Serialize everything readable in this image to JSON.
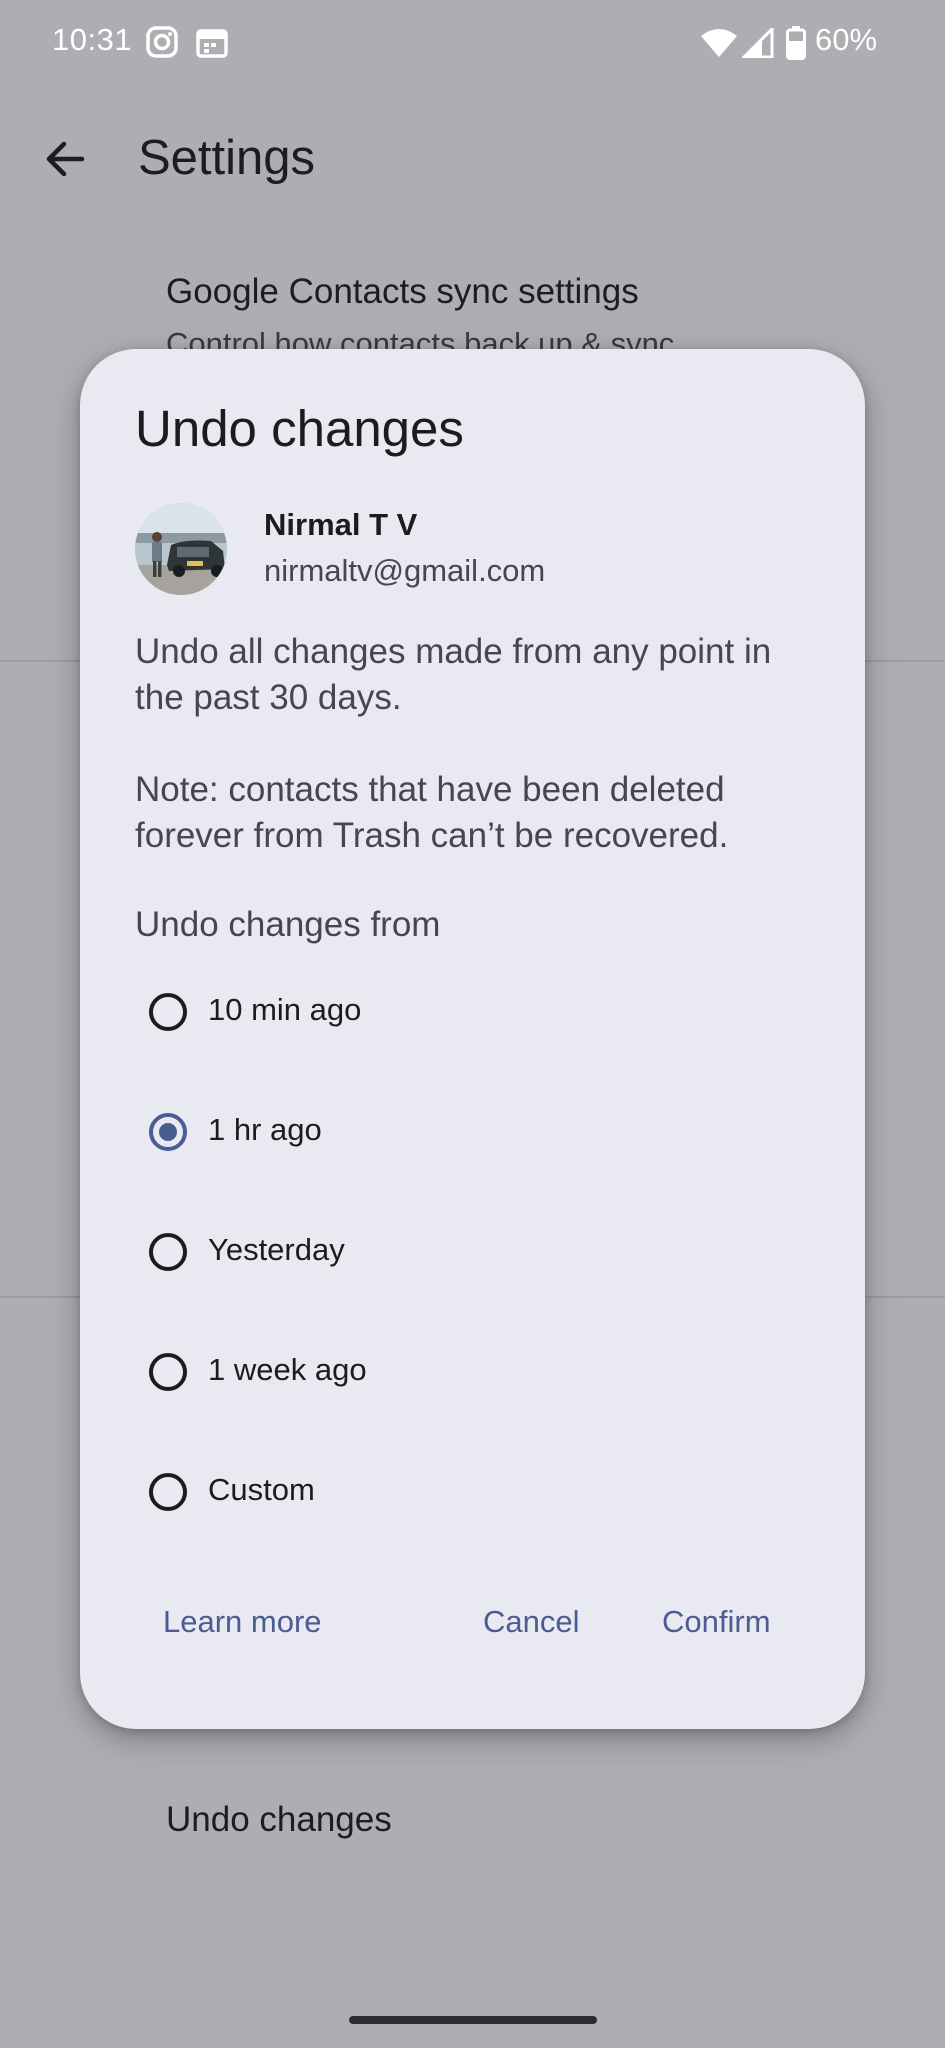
{
  "status_bar": {
    "time": "10:31",
    "battery": "60%"
  },
  "background": {
    "title": "Settings",
    "sync_item_title": "Google Contacts sync settings",
    "sync_item_subtitle": "Control how contacts back up & sync",
    "undo_item_title": "Undo changes"
  },
  "dialog": {
    "title": "Undo changes",
    "account": {
      "name": "Nirmal T V",
      "email": "nirmaltv@gmail.com"
    },
    "description": "Undo all changes made from any point in the past 30 days.",
    "note": "Note: contacts that have been deleted forever from Trash can’t be recovered.",
    "section_label": "Undo changes from",
    "options": [
      {
        "label": "10 min ago",
        "selected": false
      },
      {
        "label": "1 hr ago",
        "selected": true
      },
      {
        "label": "Yesterday",
        "selected": false
      },
      {
        "label": "1 week ago",
        "selected": false
      },
      {
        "label": "Custom",
        "selected": false
      }
    ],
    "buttons": {
      "learn_more": "Learn more",
      "cancel": "Cancel",
      "confirm": "Confirm"
    }
  },
  "colors": {
    "scrim_background": "#aeadb1",
    "dialog_surface": "#e9e9f1",
    "accent": "#4b5c92"
  }
}
